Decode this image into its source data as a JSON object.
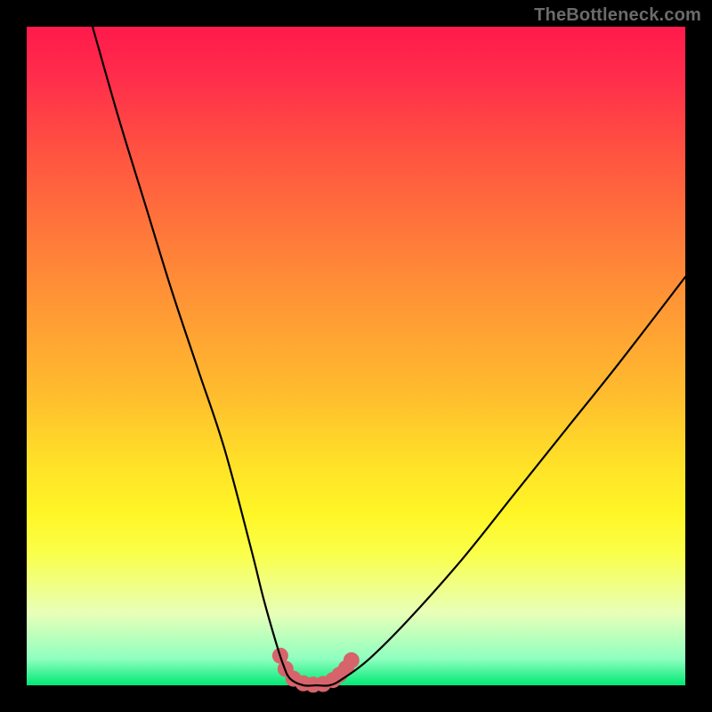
{
  "watermark": "TheBottleneck.com",
  "chart_data": {
    "type": "line",
    "title": "",
    "xlabel": "",
    "ylabel": "",
    "xlim": [
      0,
      100
    ],
    "ylim": [
      0,
      100
    ],
    "series": [
      {
        "name": "bottleneck-curve",
        "x": [
          10,
          14,
          18,
          22,
          26,
          30,
          34,
          36,
          38,
          39,
          40,
          42,
          44,
          46,
          48,
          52,
          58,
          66,
          74,
          82,
          90,
          100
        ],
        "y": [
          100,
          86,
          73,
          60,
          48,
          36,
          21,
          13,
          6,
          3,
          1,
          0,
          0,
          0,
          1,
          4,
          10,
          19,
          29,
          39,
          49,
          62
        ]
      }
    ],
    "markers": {
      "name": "highlight-dots",
      "color": "#d6646b",
      "x": [
        38.5,
        39.3,
        40.5,
        42,
        43.5,
        45,
        46.5,
        47.5,
        48.5,
        49.3
      ],
      "y": [
        4.5,
        2.5,
        1,
        0.3,
        0.1,
        0.2,
        0.8,
        1.6,
        2.6,
        3.8
      ],
      "radius_px": 9
    },
    "background_gradient": {
      "top_color": "#ff1a4b",
      "mid_color": "#ffe028",
      "bottom_color": "#00e874"
    }
  }
}
